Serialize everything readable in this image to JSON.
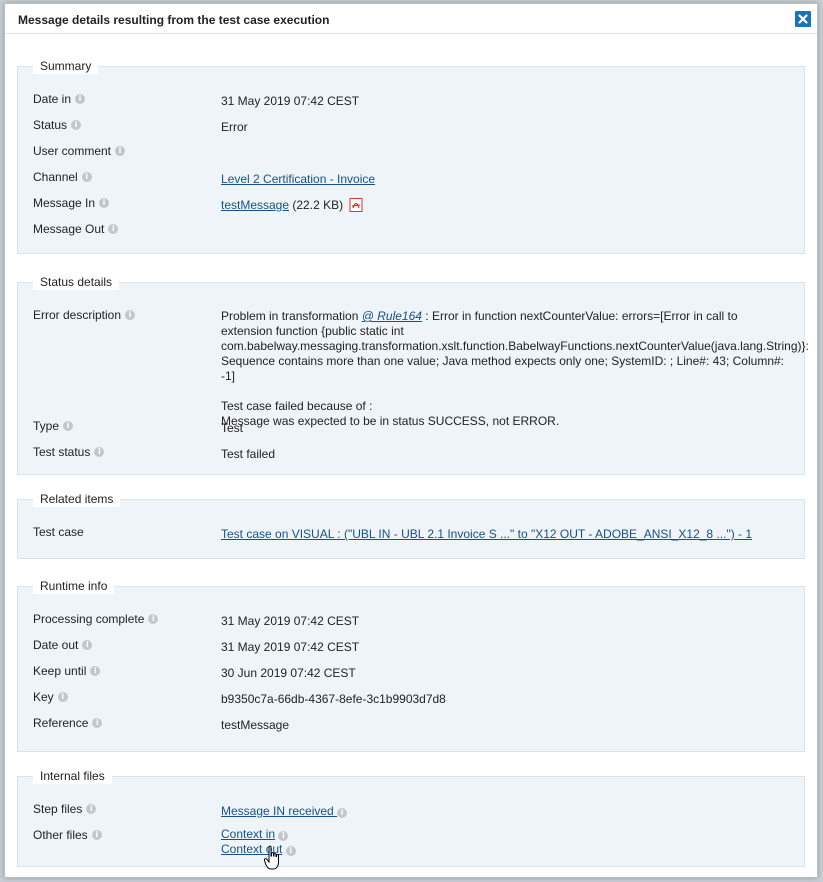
{
  "dialog": {
    "title": "Message details resulting from the test case execution",
    "close_label": "×"
  },
  "summary": {
    "legend": "Summary",
    "rows": [
      {
        "label": "Date in",
        "value": "31 May 2019 07:42 CEST"
      },
      {
        "label": "Status",
        "value": "Error"
      },
      {
        "label": "User comment",
        "value": ""
      },
      {
        "label": "Channel",
        "value": "Level 2 Certification - Invoice"
      },
      {
        "label": "Message In",
        "value": "testMessage",
        "size": "(22.2 KB)"
      },
      {
        "label": "Message Out",
        "value": ""
      }
    ]
  },
  "status_details": {
    "legend": "Status details",
    "error_label": "Error description",
    "error_prefix": "Problem in transformation ",
    "error_link": "@ Rule164",
    "error_text": " : Error in function nextCounterValue: errors=[Error in call to extension function {public static int com.babelway.messaging.transformation.xslt.function.BabelwayFunctions.nextCounterValue(java.lang.String)}: Sequence contains more than one value; Java method expects only one; SystemID: ; Line#: 43; Column#: -1]",
    "failed_line1": "Test case failed because of :",
    "failed_line2": "Message was expected to be in status SUCCESS, not ERROR.",
    "type_label": "Type",
    "type_value": "Test",
    "test_status_label": "Test status",
    "test_status_value": "Test failed"
  },
  "related": {
    "legend": "Related items",
    "test_case_label": "Test case",
    "test_case_value": "Test case on VISUAL : (\"UBL IN - UBL 2.1 Invoice S ...\" to \"X12 OUT - ADOBE_ANSI_X12_8 ...\") - 1"
  },
  "runtime": {
    "legend": "Runtime info",
    "rows": [
      {
        "label": "Processing complete",
        "value": "31 May 2019 07:42 CEST"
      },
      {
        "label": "Date out",
        "value": "31 May 2019 07:42 CEST"
      },
      {
        "label": "Keep until",
        "value": "30 Jun 2019 07:42 CEST"
      },
      {
        "label": "Key",
        "value": "b9350c7a-66db-4367-8efe-3c1b9903d7d8"
      },
      {
        "label": "Reference",
        "value": "testMessage"
      }
    ]
  },
  "internal_files": {
    "legend": "Internal files",
    "step_files_label": "Step files",
    "step_files_value": "Message IN received ",
    "other_files_label": "Other files",
    "context_in": "Context in",
    "context_out": "Context out"
  },
  "icons": {
    "info": "info-icon",
    "close": "close-icon",
    "pdf": "pdf-icon",
    "cursor": "hand-cursor-icon"
  },
  "colors": {
    "section_bg": "#eef4f8",
    "link": "#17508a",
    "close_btn": "#1a73b8",
    "info_icon": "#c2c7cc"
  }
}
